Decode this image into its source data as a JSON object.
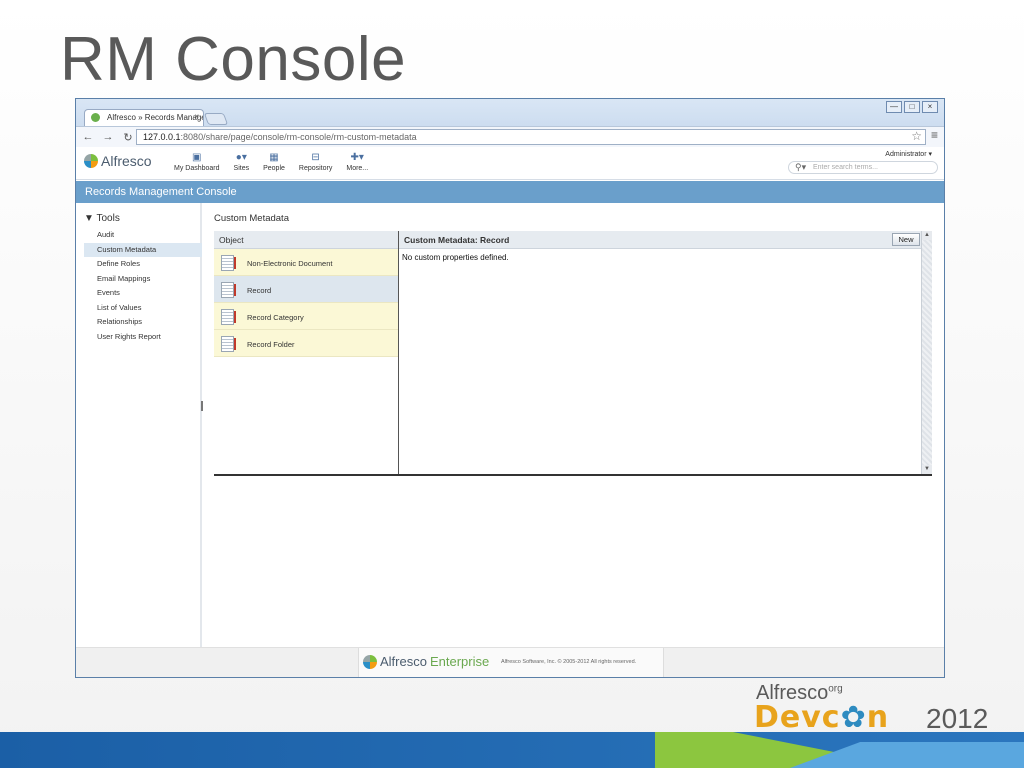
{
  "slide_title": "RM Console",
  "browser": {
    "tab_title": "Alfresco » Records Managem",
    "tab_close": "×",
    "url_host": "127.0.0.1",
    "url_rest": ":8080/share/page/console/rm-console/rm-custom-metadata",
    "win_buttons": [
      "—",
      "□",
      "×"
    ]
  },
  "app": {
    "logo_text": "Alfresco",
    "nav": [
      {
        "label": "My Dashboard",
        "icon": "dashboard-icon"
      },
      {
        "label": "Sites",
        "icon": "sites-icon"
      },
      {
        "label": "People",
        "icon": "people-icon"
      },
      {
        "label": "Repository",
        "icon": "repository-icon"
      },
      {
        "label": "More...",
        "icon": "plus-icon"
      }
    ],
    "user_menu": "Administrator ▾",
    "search_placeholder": "Enter search terms..."
  },
  "console_title": "Records Management Console",
  "tools": {
    "heading": "▼ Tools",
    "items": [
      "Audit",
      "Custom Metadata",
      "Define Roles",
      "Email Mappings",
      "Events",
      "List of Values",
      "Relationships",
      "User Rights Report"
    ],
    "active_index": 1
  },
  "main": {
    "title": "Custom Metadata",
    "object_header": "Object",
    "objects": [
      "Non-Electronic Document",
      "Record",
      "Record Category",
      "Record Folder"
    ],
    "selected_object_index": 1,
    "detail_header": "Custom Metadata:  Record",
    "new_button": "New",
    "empty_message": "No custom properties defined."
  },
  "footer": {
    "logo_text": "Alfresco",
    "logo_suffix": "Enterprise",
    "copyright": "Alfresco Software, Inc. © 2005-2012 All rights reserved."
  },
  "brand": {
    "alfresco": "Alfresco",
    "org": "org",
    "devcon_a": "Devc",
    "devcon_gear": "✿",
    "devcon_b": "n",
    "year": "2012"
  },
  "colors": {
    "console_bar": "#6a9fcb",
    "band_blue": "#1b5fa6",
    "band_green": "#8cc63f",
    "devcon_orange": "#e8a31c"
  }
}
